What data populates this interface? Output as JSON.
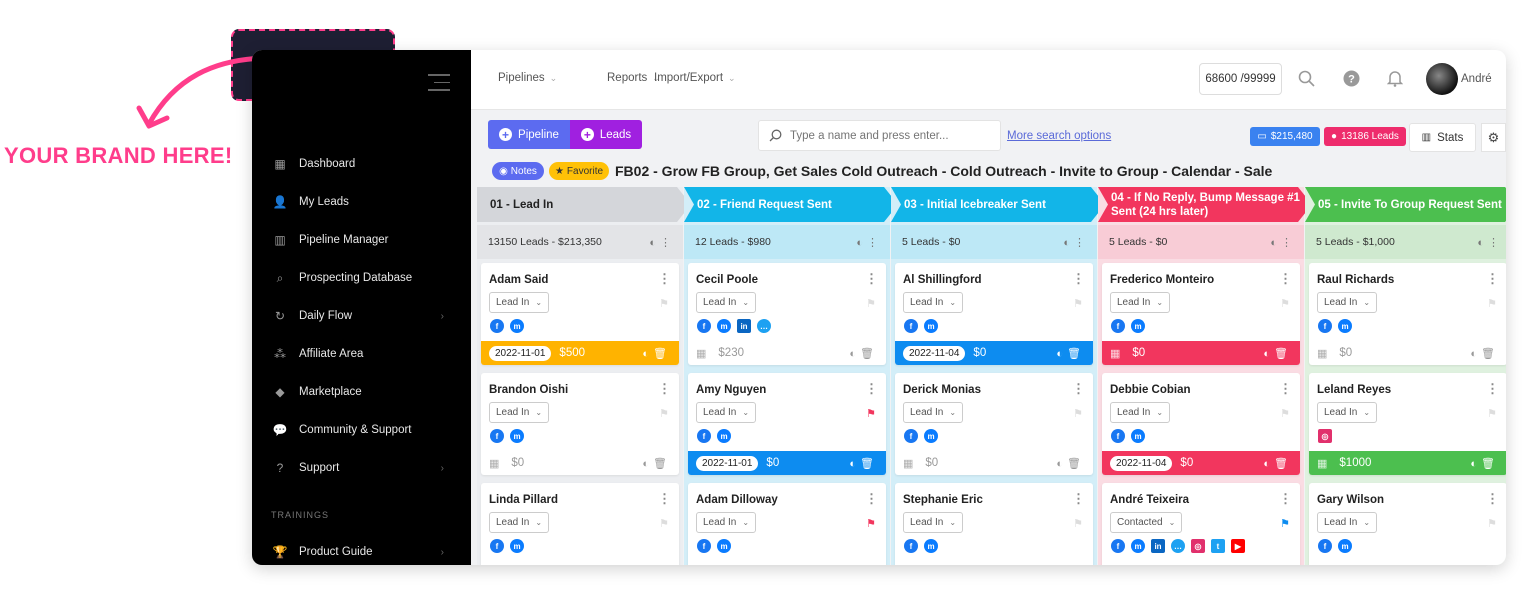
{
  "brand": {
    "promo_text": "YOUR BRAND HERE!"
  },
  "sidebar": {
    "items": [
      {
        "label": "Dashboard",
        "icon": "dashboard-icon",
        "chevron": false
      },
      {
        "label": "My Leads",
        "icon": "users-icon",
        "chevron": false
      },
      {
        "label": "Pipeline Manager",
        "icon": "columns-icon",
        "chevron": false
      },
      {
        "label": "Prospecting Database",
        "icon": "search-icon",
        "chevron": false
      },
      {
        "label": "Daily Flow",
        "icon": "refresh-icon",
        "chevron": true
      },
      {
        "label": "Affiliate Area",
        "icon": "network-icon",
        "chevron": false
      },
      {
        "label": "Marketplace",
        "icon": "tag-icon",
        "chevron": false
      },
      {
        "label": "Community & Support",
        "icon": "chat-icon",
        "chevron": false
      },
      {
        "label": "Support",
        "icon": "question-icon",
        "chevron": true
      }
    ],
    "section_label": "TRAININGS",
    "product_guide": "Product Guide"
  },
  "topbar": {
    "menus": [
      "Pipelines",
      "Reports",
      "Import/Export"
    ],
    "counter": "68600 /99999",
    "user": "André"
  },
  "toolbar": {
    "pipeline_label": "Pipeline",
    "leads_label": "Leads",
    "search_placeholder": "Type a name and press enter...",
    "more_search": "More search options",
    "value_badge": "$215,480",
    "leads_badge": "13186 Leads",
    "stats_label": "Stats"
  },
  "pipeline": {
    "notes_label": "Notes",
    "favorite_label": "Favorite",
    "title": "FB02 - Grow FB Group, Get Sales Cold Outreach - Cold Outreach - Invite to Group - Calendar - Sale"
  },
  "colors": {
    "blue": "#0d8cf0",
    "red": "#f2365e",
    "green": "#4cbf4f",
    "yellow": "#ffb300",
    "purple": "#a020e0"
  },
  "columns": [
    {
      "title": "01 - Lead In",
      "summary": "13150 Leads - $213,350",
      "head_bg": "#d4d6da",
      "head_fg": "#222",
      "sum_bg": "#e3e4e7",
      "body_bg": "#eceef1",
      "cards": [
        {
          "name": "Adam Said",
          "status": "Lead In",
          "socials": [
            "fb",
            "ms"
          ],
          "flag": "none",
          "footer": {
            "type": "yellow",
            "date": "2022-11-01",
            "amount": "$500"
          }
        },
        {
          "name": "Brandon Oishi",
          "status": "Lead In",
          "socials": [
            "fb",
            "ms"
          ],
          "flag": "none",
          "footer": {
            "type": "plain",
            "date": "",
            "amount": "$0"
          }
        },
        {
          "name": "Linda Pillard",
          "status": "Lead In",
          "socials": [
            "fb",
            "ms"
          ],
          "flag": "none",
          "footer": {
            "type": "none",
            "date": "",
            "amount": ""
          }
        }
      ]
    },
    {
      "title": "02 - Friend Request Sent",
      "summary": "12 Leads - $980",
      "head_bg": "#12b5e8",
      "head_fg": "#fff",
      "sum_bg": "#bde8f6",
      "body_bg": "#d3eef8",
      "cards": [
        {
          "name": "Cecil Poole",
          "status": "Lead In",
          "socials": [
            "fb",
            "ms",
            "li",
            "chat"
          ],
          "flag": "none",
          "footer": {
            "type": "plain",
            "date": "",
            "amount": "$230"
          }
        },
        {
          "name": "Amy Nguyen",
          "status": "Lead In",
          "socials": [
            "fb",
            "ms"
          ],
          "flag": "red",
          "footer": {
            "type": "blue",
            "date": "2022-11-01",
            "amount": "$0"
          }
        },
        {
          "name": "Adam Dilloway",
          "status": "Lead In",
          "socials": [
            "fb",
            "ms"
          ],
          "flag": "red",
          "footer": {
            "type": "stripe",
            "date": "",
            "amount": ""
          }
        }
      ]
    },
    {
      "title": "03 - Initial Icebreaker Sent",
      "summary": "5 Leads - $0",
      "head_bg": "#12b5e8",
      "head_fg": "#fff",
      "sum_bg": "#bde8f6",
      "body_bg": "#d3eef8",
      "cards": [
        {
          "name": "Al Shillingford",
          "status": "Lead In",
          "socials": [
            "fb",
            "ms"
          ],
          "flag": "none",
          "footer": {
            "type": "blue",
            "date": "2022-11-04",
            "amount": "$0"
          }
        },
        {
          "name": "Derick Monias",
          "status": "Lead In",
          "socials": [
            "fb",
            "ms"
          ],
          "flag": "none",
          "footer": {
            "type": "plain",
            "date": "",
            "amount": "$0"
          }
        },
        {
          "name": "Stephanie Eric",
          "status": "Lead In",
          "socials": [
            "fb",
            "ms"
          ],
          "flag": "none",
          "footer": {
            "type": "none",
            "date": "",
            "amount": ""
          }
        }
      ]
    },
    {
      "title": "04 - If No Reply, Bump Message #1 Sent (24 hrs later)",
      "summary": "5 Leads - $0",
      "head_bg": "#f2365e",
      "head_fg": "#fff",
      "sum_bg": "#f8ccd6",
      "body_bg": "#fadce3",
      "cards": [
        {
          "name": "Frederico Monteiro",
          "status": "Lead In",
          "socials": [
            "fb",
            "ms"
          ],
          "flag": "none",
          "footer": {
            "type": "red",
            "date": "",
            "amount": "$0"
          }
        },
        {
          "name": "Debbie Cobian",
          "status": "Lead In",
          "socials": [
            "fb",
            "ms"
          ],
          "flag": "none",
          "footer": {
            "type": "red",
            "date": "2022-11-04",
            "amount": "$0"
          }
        },
        {
          "name": "André Teixeira",
          "status": "Contacted",
          "socials": [
            "fb",
            "ms",
            "li",
            "chat",
            "ig",
            "tw",
            "yt"
          ],
          "flag": "blue",
          "footer": {
            "type": "none",
            "date": "",
            "amount": ""
          }
        }
      ]
    },
    {
      "title": "05 - Invite To Group Request Sent",
      "summary": "5 Leads - $1,000",
      "head_bg": "#4cbf4f",
      "head_fg": "#fff",
      "sum_bg": "#cfe9cf",
      "body_bg": "#dff1df",
      "cards": [
        {
          "name": "Raul Richards",
          "status": "Lead In",
          "socials": [
            "fb",
            "ms"
          ],
          "flag": "none",
          "footer": {
            "type": "plain",
            "date": "",
            "amount": "$0"
          }
        },
        {
          "name": "Leland Reyes",
          "status": "Lead In",
          "socials": [
            "ig"
          ],
          "flag": "none",
          "footer": {
            "type": "green",
            "date": "",
            "amount": "$1000"
          }
        },
        {
          "name": "Gary Wilson",
          "status": "Lead In",
          "socials": [
            "fb",
            "ms"
          ],
          "flag": "none",
          "footer": {
            "type": "none",
            "date": "",
            "amount": ""
          }
        }
      ]
    }
  ]
}
